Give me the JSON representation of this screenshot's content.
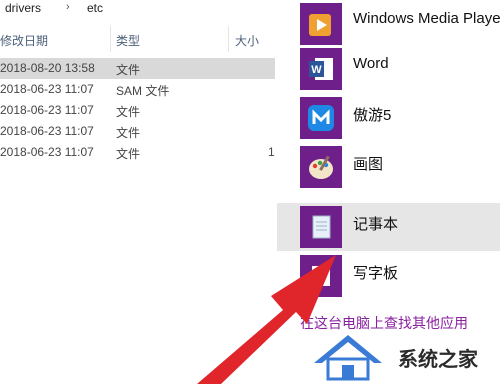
{
  "breadcrumb": {
    "items": [
      "drivers",
      "etc"
    ],
    "separator": "›"
  },
  "columns": {
    "date": "修改日期",
    "type": "类型",
    "size": "大小"
  },
  "files": [
    {
      "date": "2018-08-20 13:58",
      "type": "文件",
      "size": "",
      "selected": true
    },
    {
      "date": "2018-06-23 11:07",
      "type": "SAM 文件",
      "size": ""
    },
    {
      "date": "2018-06-23 11:07",
      "type": "文件",
      "size": ""
    },
    {
      "date": "2018-06-23 11:07",
      "type": "文件",
      "size": ""
    },
    {
      "date": "2018-06-23 11:07",
      "type": "文件",
      "size": "1"
    }
  ],
  "apps": [
    {
      "label": "Windows Media Player",
      "icon": "media-player-icon",
      "color": "#6f1f8a"
    },
    {
      "label": "Word",
      "icon": "word-icon",
      "color": "#6f1f8a"
    },
    {
      "label": "傲游5",
      "icon": "maxthon-icon",
      "color": "#6f1f8a"
    },
    {
      "label": "画图",
      "icon": "paint-icon",
      "color": "#6f1f8a"
    },
    {
      "label": "记事本",
      "icon": "notepad-icon",
      "color": "#6f1f8a",
      "hover": true
    },
    {
      "label": "写字板",
      "icon": "wordpad-icon",
      "color": "#6f1f8a"
    }
  ],
  "more_apps_link": "在这台电脑上查找其他应用",
  "watermark": {
    "text": "系统之家"
  },
  "colors": {
    "tile": "#6f1f8a",
    "arrow": "#e0262b",
    "link": "#8a1fa0"
  }
}
